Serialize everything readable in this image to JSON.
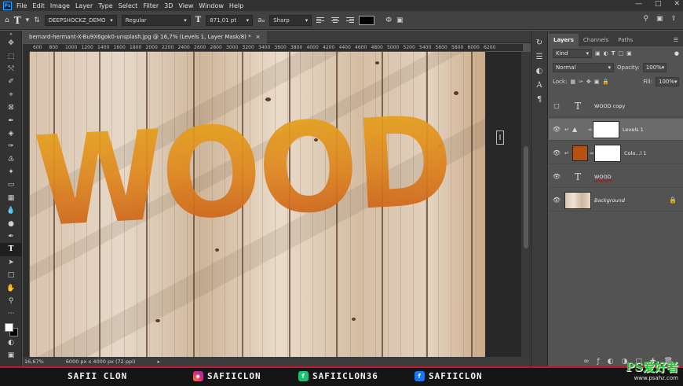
{
  "menu": {
    "logo": "Ps",
    "items": [
      "File",
      "Edit",
      "Image",
      "Layer",
      "Type",
      "Select",
      "Filter",
      "3D",
      "View",
      "Window",
      "Help"
    ]
  },
  "options_bar": {
    "tool_icon": "T",
    "font_family": "DEEPSHOCKZ_DEMO",
    "font_style": "Regular",
    "font_size": "871,01 pt",
    "aa_label": "aₐ",
    "antialias": "Sharp"
  },
  "document": {
    "tab_title": "bernard-hermant-X-Bu9X6gok0-unsplash.jpg @ 16,7% (Levels 1, Layer Mask/8) *",
    "close_glyph": "×",
    "ruler_ticks": [
      "600",
      "800",
      "1000",
      "1200",
      "1400",
      "1600",
      "1800",
      "2000",
      "2200",
      "2400",
      "2600",
      "2800",
      "3000",
      "3200",
      "3400",
      "3600",
      "3800",
      "4000",
      "4200",
      "4400",
      "4600",
      "4800",
      "5000",
      "5200",
      "5400",
      "5600",
      "5800",
      "6000",
      "6200"
    ],
    "canvas_text": "WOOD",
    "zoom": "16,67%",
    "doc_info": "6000 px x 4000 px (72 ppi)"
  },
  "layers_panel": {
    "tabs": [
      "Layers",
      "Channels",
      "Paths"
    ],
    "filter_label": "Kind",
    "blend_mode": "Normal",
    "opacity_label": "Opacity:",
    "opacity_value": "100%",
    "lock_label": "Lock:",
    "fill_label": "Fill:",
    "fill_value": "100%",
    "layers": [
      {
        "name": "WOOD copy",
        "kind": "text",
        "visible": false,
        "selected": false
      },
      {
        "name": "Levels 1",
        "kind": "adjustment",
        "visible": true,
        "selected": true
      },
      {
        "name": "Colo...l 1",
        "kind": "fill",
        "visible": true,
        "selected": false,
        "color": "#b5520f"
      },
      {
        "name": "WOOD",
        "kind": "text",
        "visible": true,
        "selected": false
      },
      {
        "name": "Background",
        "kind": "image",
        "visible": true,
        "selected": false,
        "locked": true
      }
    ]
  },
  "banner": {
    "name": "SAFII CLON",
    "instagram": "SAFIICLON",
    "fiverr": "SAFIICLON36",
    "facebook": "SAFIICLON",
    "bg_color": "#151515",
    "accent_color": "#c3172c"
  },
  "watermark": {
    "main": "PS爱好者",
    "sub": "www.psahz.com"
  },
  "colors": {
    "ui_dark": "#323232",
    "panel": "#535353",
    "text_gradient_top": "#e6a61c",
    "text_gradient_bottom": "#c95a18"
  }
}
